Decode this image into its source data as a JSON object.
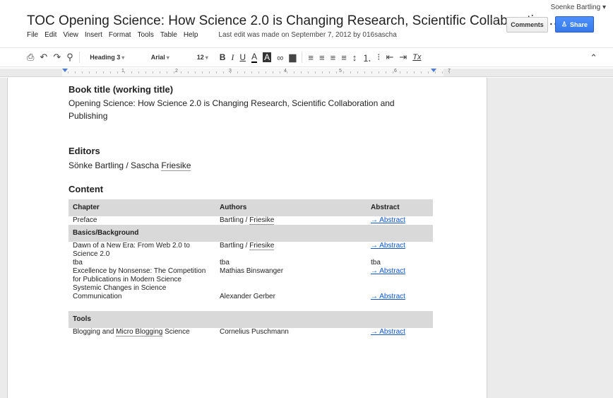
{
  "header": {
    "user_name": "Soenke Bartling",
    "user_caret": "▾",
    "title": "TOC Opening Science: How Science 2.0 is Changing Research, Scientific Collaboration…",
    "comments_label": "Comments",
    "share_label": "Share",
    "star_glyph": "☆",
    "share_glyph": "♙"
  },
  "menu": {
    "items": [
      "File",
      "Edit",
      "View",
      "Insert",
      "Format",
      "Tools",
      "Table",
      "Help"
    ],
    "last_edit": "Last edit was made on September 7, 2012 by 016sascha"
  },
  "toolbar": {
    "print_glyph": "⎙",
    "undo_glyph": "↶",
    "redo_glyph": "↷",
    "paint_glyph": "⚲",
    "style": "Heading 3",
    "font": "Arial",
    "size": "12",
    "bold": "B",
    "italic": "I",
    "underline": "U",
    "text_color": "A",
    "highlight": "A",
    "link_glyph": "∞",
    "comment_glyph": "▆",
    "align_left": "≡",
    "align_center": "≡",
    "align_right": "≡",
    "align_justify": "≡",
    "line_spacing": "↕",
    "numbered_list": "⒈",
    "bulleted_list": "⁝",
    "indent_less": "⇤",
    "indent_more": "⇥",
    "clear_format": "Tx",
    "collapse_glyph": "⌃"
  },
  "ruler": {
    "numbers": [
      "1",
      "2",
      "3",
      "4",
      "5",
      "6",
      "7"
    ]
  },
  "document": {
    "book_title_heading": "Book title (working title)",
    "book_title_line1": "Opening Science: How Science 2.0 is Changing Research, Scientific Collaboration and",
    "book_title_line2": "Publishing",
    "editors_heading": "Editors",
    "editors_prefix": "Sönke Bartling / Sascha ",
    "editors_surname": "Friesike",
    "content_heading": "Content",
    "table": {
      "headers": [
        "Chapter",
        "Authors",
        "Abstract"
      ],
      "rows": [
        {
          "type": "data",
          "chapter": "Preface",
          "author_a": "Bartling / ",
          "author_b": "Friesike",
          "abstract": "→ Abstract"
        },
        {
          "type": "section",
          "label": "Basics/Background"
        },
        {
          "type": "data",
          "chapter": "Dawn of a New Era: From Web 2.0 to Science 2.0",
          "author_a": "Bartling / ",
          "author_b": "Friesike",
          "abstract": "→ Abstract"
        },
        {
          "type": "data",
          "chapter": "tba",
          "author_a": "tba",
          "author_b": "",
          "abstract": "tba"
        },
        {
          "type": "data",
          "chapter": "Excellence by Nonsense: The Competition for Publications in Modern Science",
          "author_a": "Mathias Binswanger",
          "author_b": "",
          "abstract": "→ Abstract"
        },
        {
          "type": "data",
          "chapter": "Systemic Changes in Science Communication",
          "author_a": "Alexander Gerber",
          "author_b": "",
          "abstract": "→ Abstract"
        },
        {
          "type": "section",
          "label": "Tools"
        },
        {
          "type": "data",
          "chapter_a": "Blogging and ",
          "chapter_b": "Micro Blogging",
          "chapter_c": " Science",
          "author_a": "Cornelius Puschmann",
          "author_b": "",
          "abstract": "→ Abstract"
        }
      ]
    }
  }
}
